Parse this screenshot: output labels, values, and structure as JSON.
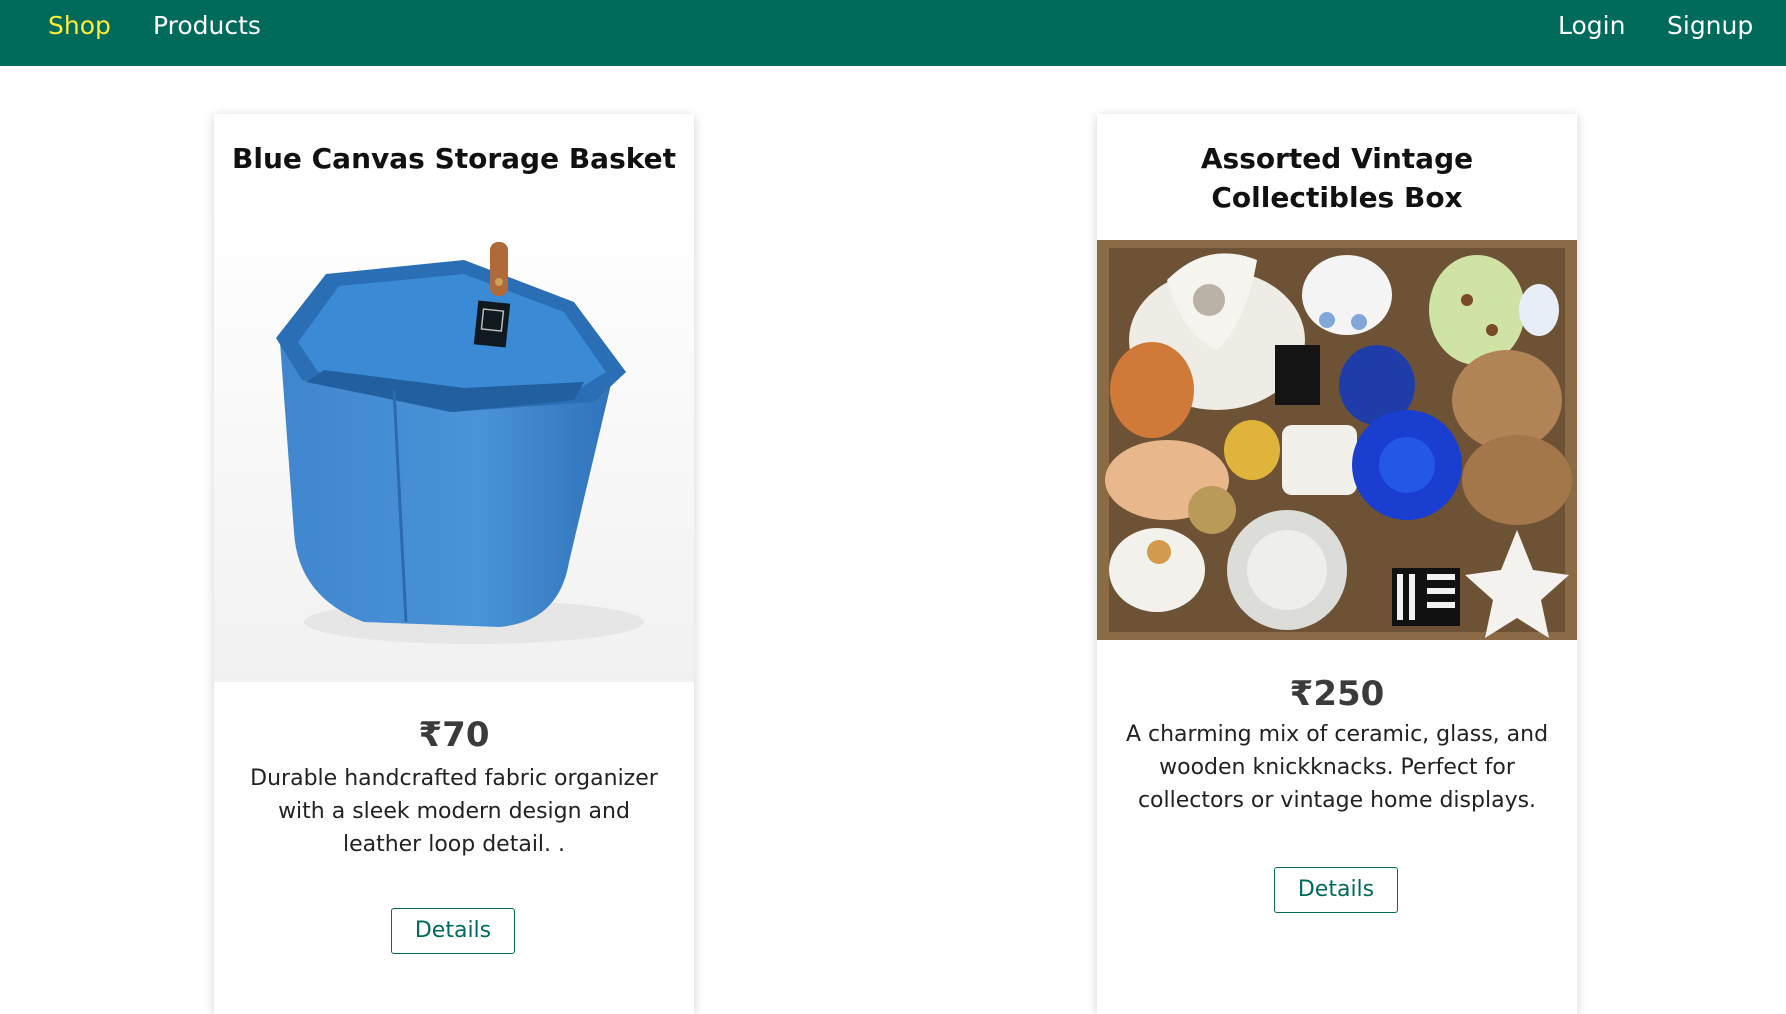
{
  "nav": {
    "shop": "Shop",
    "products": "Products",
    "login": "Login",
    "signup": "Signup",
    "active_color": "#ffeb3b",
    "bar_color": "#006b5b"
  },
  "products": [
    {
      "title": "Blue Canvas Storage Basket",
      "price": "₹70",
      "description": "Durable handcrafted fabric organizer with a sleek modern design and leather loop detail. .",
      "button": "Details"
    },
    {
      "title": "Assorted Vintage Collectibles Box",
      "price": "₹250",
      "description": "A charming mix of ceramic, glass, and wooden knickknacks. Perfect for collectors or vintage home displays.",
      "button": "Details"
    }
  ]
}
